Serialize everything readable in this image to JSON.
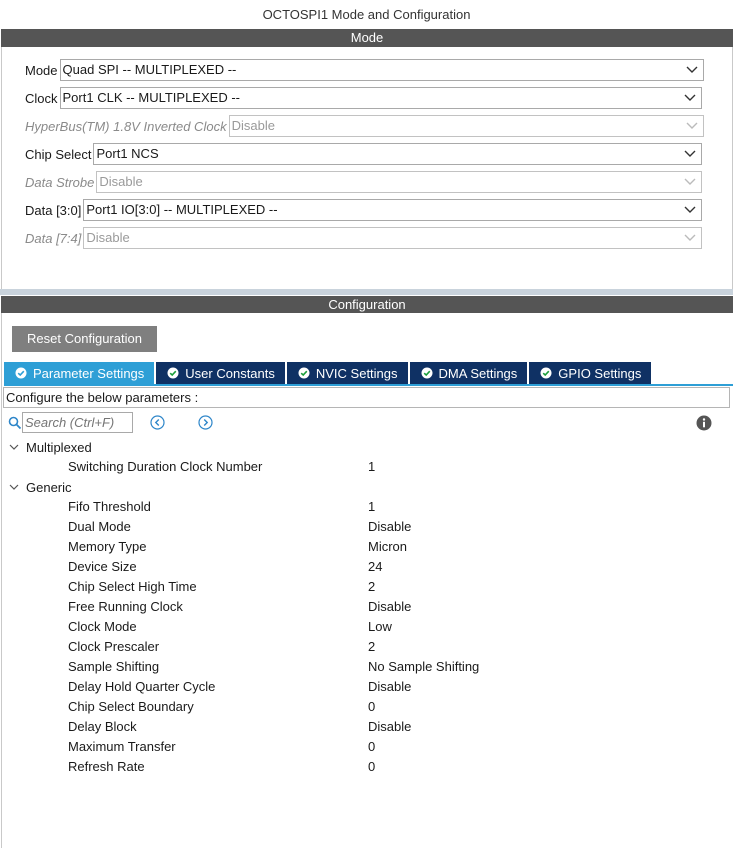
{
  "window_title": "OCTOSPI1 Mode and Configuration",
  "mode_header": "Mode",
  "mode_fields": [
    {
      "label": "Mode",
      "value": "Quad SPI -- MULTIPLEXED --"
    },
    {
      "label": "Clock",
      "value": "Port1 CLK -- MULTIPLEXED --"
    },
    {
      "label": "HyperBus(TM) 1.8V Inverted Clock",
      "value": "Disable"
    },
    {
      "label": "Chip Select",
      "value": "Port1 NCS"
    },
    {
      "label": "Data Strobe",
      "value": "Disable"
    },
    {
      "label": "Data [3:0]",
      "value": "Port1 IO[3:0] -- MULTIPLEXED --"
    },
    {
      "label": "Data [7:4]",
      "value": "Disable"
    }
  ],
  "config_header": "Configuration",
  "reset_button": "Reset Configuration",
  "tabs": [
    "Parameter Settings",
    "User Constants",
    "NVIC Settings",
    "DMA Settings",
    "GPIO Settings"
  ],
  "hint": "Configure the below parameters :",
  "search_placeholder": "Search (Ctrl+F)",
  "groups": [
    {
      "name": "Multiplexed",
      "params": [
        {
          "name": "Switching Duration Clock Number",
          "value": "1"
        }
      ]
    },
    {
      "name": "Generic",
      "params": [
        {
          "name": "Fifo Threshold",
          "value": "1"
        },
        {
          "name": "Dual Mode",
          "value": "Disable"
        },
        {
          "name": "Memory Type",
          "value": "Micron"
        },
        {
          "name": "Device Size",
          "value": "24"
        },
        {
          "name": "Chip Select High Time",
          "value": "2"
        },
        {
          "name": "Free Running Clock",
          "value": "Disable"
        },
        {
          "name": "Clock Mode",
          "value": "Low"
        },
        {
          "name": "Clock Prescaler",
          "value": "2"
        },
        {
          "name": "Sample Shifting",
          "value": "No Sample Shifting"
        },
        {
          "name": "Delay Hold Quarter Cycle",
          "value": "Disable"
        },
        {
          "name": "Chip Select Boundary",
          "value": "0"
        },
        {
          "name": "Delay Block",
          "value": "Disable"
        },
        {
          "name": "Maximum Transfer",
          "value": "0"
        },
        {
          "name": "Refresh Rate",
          "value": "0"
        }
      ]
    }
  ],
  "colors": {
    "section_bar": "#555555",
    "tab_active": "#2e9fd6",
    "tab_inactive": "#0f3164",
    "reset_button": "#7f7f7f"
  }
}
